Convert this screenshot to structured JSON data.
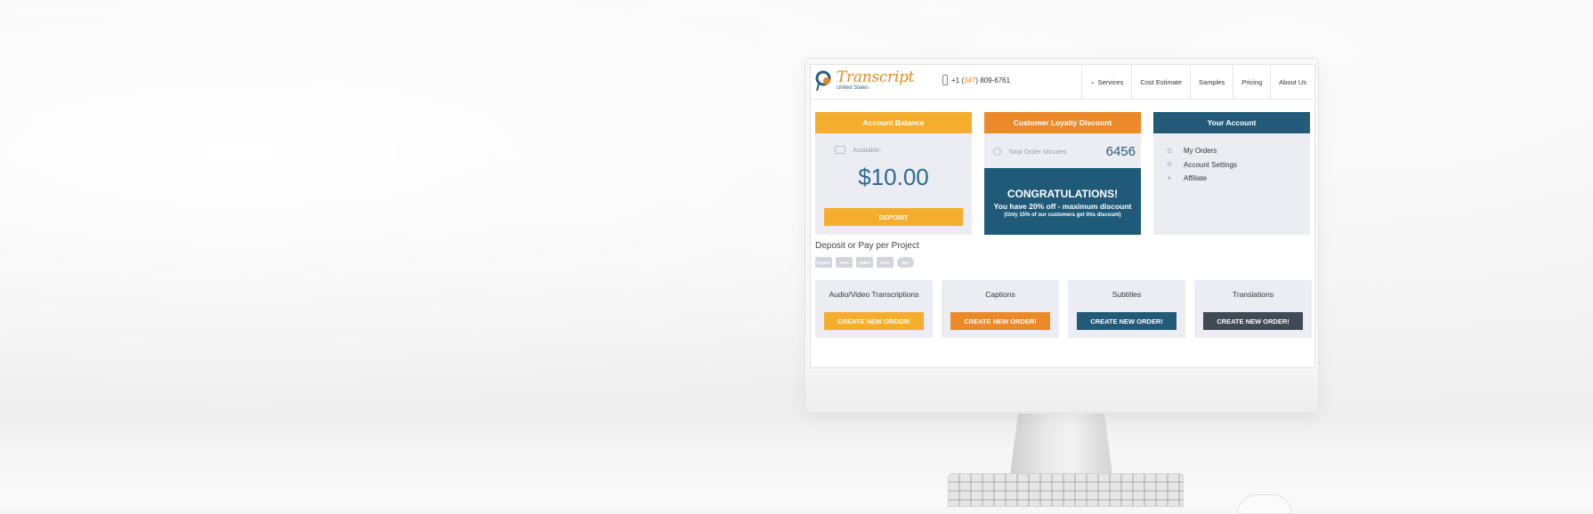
{
  "site": {
    "logo": {
      "name": "Transcript",
      "sub": "United States"
    },
    "phone": {
      "prefix": "+1 (",
      "area": "347",
      "rest": ") 809-6761"
    },
    "nav": [
      {
        "label": "Services"
      },
      {
        "label": "Cost Estimate"
      },
      {
        "label": "Samples"
      },
      {
        "label": "Pricing"
      },
      {
        "label": "About Us"
      }
    ]
  },
  "account_balance": {
    "header": "Account Balance",
    "available_label": "Available:",
    "amount": "$10.00",
    "deposit_button": "DEPOSIT"
  },
  "loyalty": {
    "header": "Customer Loyalty Discount",
    "minutes_label": "Total Order Minutes",
    "minutes_value": "6456",
    "congrats_title": "CONGRATULATIONS!",
    "congrats_line": "You have 20% off - maximum discount",
    "congrats_note": "(Only 15% of our customers get this discount)"
  },
  "your_account": {
    "header": "Your Account",
    "items": [
      {
        "label": "My Orders",
        "icon": "list-icon"
      },
      {
        "label": "Account Settings",
        "icon": "gear-icon"
      },
      {
        "label": "Affiliate",
        "icon": "people-icon"
      }
    ]
  },
  "payment": {
    "title": "Deposit or Pay per Project",
    "methods": [
      "PayPal",
      "VISA",
      "AMEX",
      "VISA",
      "MC"
    ]
  },
  "services": [
    {
      "title": "Audio/Video Transcriptions",
      "button": "CREATE NEW ORDER!",
      "color": "#f5ad2e"
    },
    {
      "title": "Captions",
      "button": "CREATE NEW ORDER!",
      "color": "#ec8a2a"
    },
    {
      "title": "Subtitles",
      "button": "CREATE NEW ORDER!",
      "color": "#235a78"
    },
    {
      "title": "Translations",
      "button": "CREATE NEW ORDER!",
      "color": "#3f4a54"
    }
  ],
  "colors": {
    "orange_light": "#f5ad2e",
    "orange": "#ec8a2a",
    "blue": "#235a78",
    "dark": "#3f4a54"
  }
}
